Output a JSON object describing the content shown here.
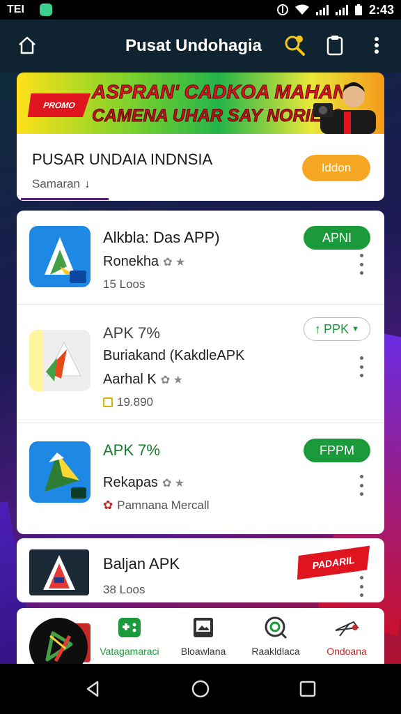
{
  "status_bar": {
    "left_text": "TEI",
    "time": "2:43"
  },
  "app_bar": {
    "title": "Pusat Undohagia",
    "icons": [
      "home-icon",
      "search-coin-icon",
      "clipboard-icon",
      "more-vertical-icon"
    ]
  },
  "banner": {
    "tag": "PROMO",
    "line1": "ASPRAN' CADKOA MAHAN",
    "line2": "CAMENA UHAR SAY NORIEL3",
    "image": "person-with-camera"
  },
  "header": {
    "title": "PUSAR UNDAIA INDNSIA",
    "subtitle": "Samaran",
    "action_label": "Iddon"
  },
  "apps": [
    {
      "name": "Alkbla: Das APP)",
      "sub": "Ronekha",
      "meta": "15 Loos",
      "button": "APNI",
      "button_style": "green",
      "icon_colors": [
        "#1e88e5",
        "#43a047",
        "#ffca28"
      ]
    },
    {
      "name": "APK 7%",
      "sub": "Buriakand (KakdleAPK",
      "sub2": "Aarhal K",
      "meta": "19.890",
      "button": "PPK",
      "button_style": "outline",
      "icon_colors": [
        "#eeeeee",
        "#e64a19",
        "#43a047"
      ]
    },
    {
      "name": "APK 7%",
      "sub": "Rekapas",
      "meta": "Pamnana Mercall",
      "button": "FPPM",
      "button_style": "green",
      "icon_colors": [
        "#1e88e5",
        "#2e7d32",
        "#fdd835"
      ]
    }
  ],
  "featured": {
    "name": "Baljan APK",
    "meta": "38 Loos",
    "ribbon": "PADARIL"
  },
  "bottom_nav": [
    {
      "label": "Vatagamaraci",
      "icon": "gamepad-icon",
      "color": "#1a9a3a"
    },
    {
      "label": "Bloawlana",
      "icon": "image-icon",
      "color": "#333333"
    },
    {
      "label": "Raakldlaca",
      "icon": "at-search-icon",
      "color": "#333333"
    },
    {
      "label": "Ondoana",
      "icon": "plane-icon",
      "color": "#c62828"
    }
  ],
  "colors": {
    "primary_green": "#1a9a3a",
    "accent_orange": "#f5a623",
    "app_bar": "#0f2430",
    "tab_underline": "#5e1f78"
  }
}
